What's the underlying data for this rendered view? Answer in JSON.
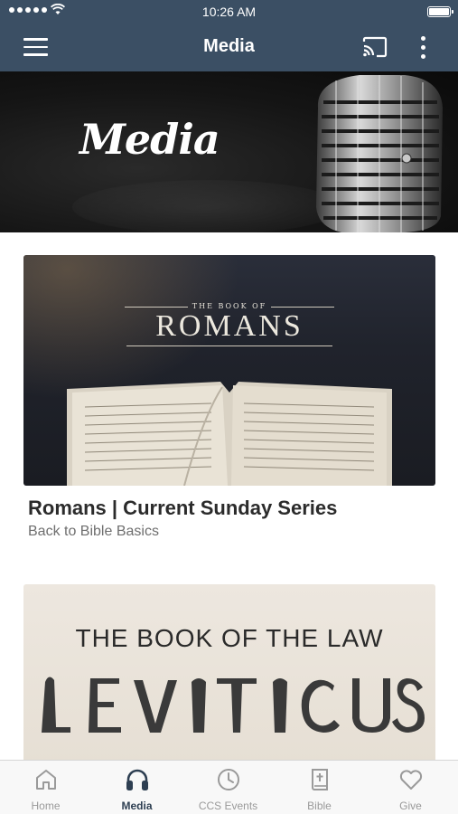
{
  "status_bar": {
    "time": "10:26 AM"
  },
  "nav": {
    "title": "Media"
  },
  "hero": {
    "title": "Media"
  },
  "cards": [
    {
      "art_kicker": "THE BOOK OF",
      "art_title": "ROMANS",
      "title": "Romans | Current Sunday Series",
      "subtitle": "Back to Bible Basics"
    },
    {
      "art_line": "THE BOOK OF THE LAW",
      "art_word": "LEVITICUS"
    }
  ],
  "tabs": [
    {
      "label": "Home",
      "icon": "home-icon",
      "active": false
    },
    {
      "label": "Media",
      "icon": "headphones-icon",
      "active": true
    },
    {
      "label": "CCS Events",
      "icon": "clock-icon",
      "active": false
    },
    {
      "label": "Bible",
      "icon": "bible-icon",
      "active": false
    },
    {
      "label": "Give",
      "icon": "heart-icon",
      "active": false
    }
  ],
  "colors": {
    "nav_bg": "#3b4f64",
    "tab_active": "#2e3f52",
    "tab_inactive": "#9a9a9a"
  }
}
